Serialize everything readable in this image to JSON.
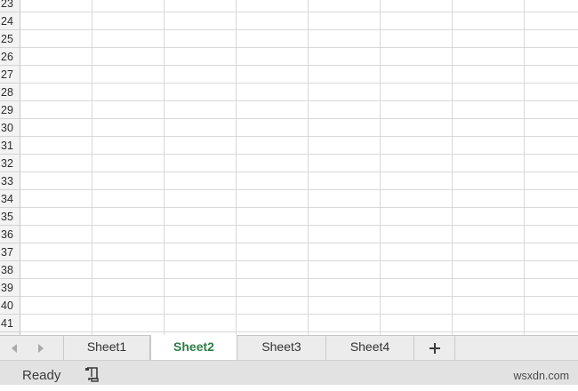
{
  "grid": {
    "rows": [
      "23",
      "24",
      "25",
      "26",
      "27",
      "28",
      "29",
      "30",
      "31",
      "32",
      "33",
      "34",
      "35",
      "36",
      "37",
      "38",
      "39",
      "40",
      "41"
    ]
  },
  "sheet_tabs": {
    "prev_icon": "chevron-left-icon",
    "next_icon": "chevron-right-icon",
    "tabs": [
      {
        "label": "Sheet1",
        "active": false
      },
      {
        "label": "Sheet2",
        "active": true
      },
      {
        "label": "Sheet3",
        "active": false
      },
      {
        "label": "Sheet4",
        "active": false
      }
    ],
    "add_icon": "plus-icon",
    "active_color": "#2e7d45"
  },
  "status_bar": {
    "status": "Ready",
    "macro_icon": "macro-record-icon",
    "watermark": "wsxdn.com"
  }
}
